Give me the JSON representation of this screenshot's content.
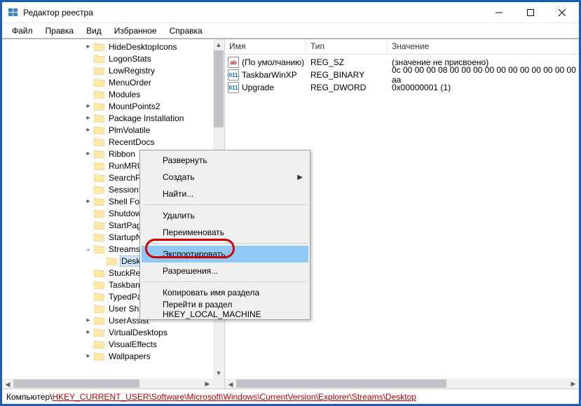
{
  "window": {
    "title": "Редактор реестра"
  },
  "menu": {
    "file": "Файл",
    "edit": "Правка",
    "view": "Вид",
    "favorites": "Избранное",
    "help": "Справка"
  },
  "tree": {
    "items": [
      {
        "indent": 116,
        "exp": "▸",
        "label": "HideDesktopIcons"
      },
      {
        "indent": 116,
        "exp": "",
        "label": "LogonStats"
      },
      {
        "indent": 116,
        "exp": "",
        "label": "LowRegistry"
      },
      {
        "indent": 116,
        "exp": "",
        "label": "MenuOrder"
      },
      {
        "indent": 116,
        "exp": "",
        "label": "Modules"
      },
      {
        "indent": 116,
        "exp": "▸",
        "label": "MountPoints2"
      },
      {
        "indent": 116,
        "exp": "▸",
        "label": "Package Installation"
      },
      {
        "indent": 116,
        "exp": "▸",
        "label": "PlmVolatile"
      },
      {
        "indent": 116,
        "exp": "",
        "label": "RecentDocs"
      },
      {
        "indent": 116,
        "exp": "▸",
        "label": "Ribbon"
      },
      {
        "indent": 116,
        "exp": "",
        "label": "RunMRU"
      },
      {
        "indent": 116,
        "exp": "",
        "label": "SearchPlatform"
      },
      {
        "indent": 116,
        "exp": "",
        "label": "SessionInfo"
      },
      {
        "indent": 116,
        "exp": "▸",
        "label": "Shell Folders"
      },
      {
        "indent": 116,
        "exp": "",
        "label": "Shutdown"
      },
      {
        "indent": 116,
        "exp": "",
        "label": "StartPage"
      },
      {
        "indent": 116,
        "exp": "",
        "label": "StartupNotify"
      },
      {
        "indent": 116,
        "exp": "⌄",
        "label": "Streams"
      },
      {
        "indent": 134,
        "exp": "",
        "label": "Desktop",
        "selected": true
      },
      {
        "indent": 116,
        "exp": "",
        "label": "StuckRects3"
      },
      {
        "indent": 116,
        "exp": "",
        "label": "Taskband"
      },
      {
        "indent": 116,
        "exp": "",
        "label": "TypedPaths"
      },
      {
        "indent": 116,
        "exp": "",
        "label": "User Shell Folders"
      },
      {
        "indent": 116,
        "exp": "▸",
        "label": "UserAssist"
      },
      {
        "indent": 116,
        "exp": "▸",
        "label": "VirtualDesktops"
      },
      {
        "indent": 116,
        "exp": "",
        "label": "VisualEffects"
      },
      {
        "indent": 116,
        "exp": "▸",
        "label": "Wallpapers"
      }
    ]
  },
  "list": {
    "headers": {
      "name": "Имя",
      "type": "Тип",
      "value": "Значение"
    },
    "rows": [
      {
        "icon": "ab",
        "iconColor": "#c00000",
        "name": "(По умолчанию)",
        "type": "REG_SZ",
        "value": "(значение не присвоено)"
      },
      {
        "icon": "011",
        "iconColor": "#0066cc",
        "name": "TaskbarWinXP",
        "type": "REG_BINARY",
        "value": "0c 00 00 00 08 00 00 00 00 00 00 00 00 00 00 00 aa"
      },
      {
        "icon": "011",
        "iconColor": "#0066cc",
        "name": "Upgrade",
        "type": "REG_DWORD",
        "value": "0x00000001 (1)"
      }
    ]
  },
  "context": {
    "expand": "Развернуть",
    "create": "Создать",
    "find": "Найти...",
    "delete": "Удалить",
    "rename": "Переименовать",
    "export": "Экспортировать",
    "permissions": "Разрешения...",
    "copyKeyName": "Копировать имя раздела",
    "goToHKLM": "Перейти в раздел HKEY_LOCAL_MACHINE"
  },
  "status": {
    "prefix": "Компьютер\\",
    "path": "HKEY_CURRENT_USER\\Software\\Microsoft\\Windows\\CurrentVersion\\Explorer\\Streams\\Desktop"
  }
}
